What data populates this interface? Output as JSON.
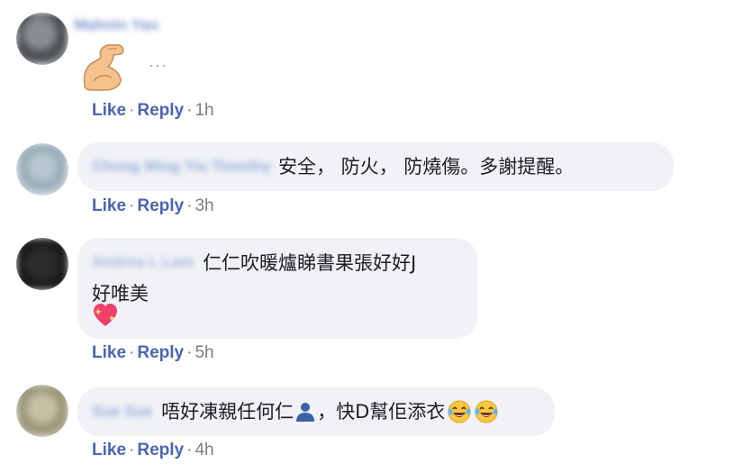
{
  "comments": [
    {
      "author": "Mahnin Yau",
      "text": "",
      "emoji": "flexed-biceps-emoji",
      "more": "···",
      "actions": {
        "like": "Like",
        "sep": "·",
        "reply": "Reply",
        "time": "1h"
      }
    },
    {
      "author": "Chong Ming Yiu Timothy",
      "text": "安全， 防火， 防燒傷。多謝提醒。",
      "actions": {
        "like": "Like",
        "sep": "·",
        "reply": "Reply",
        "time": "3h"
      }
    },
    {
      "author": "Andrea L Lam",
      "text_line1": "仁仁吹暖爐睇書果張好好J",
      "text_line2": "好唯美",
      "emoji": "sparkling-heart-emoji",
      "actions": {
        "like": "Like",
        "sep": "·",
        "reply": "Reply",
        "time": "5h"
      }
    },
    {
      "author": "Sue Sue",
      "text_a": "唔好凍親任何仁",
      "text_b": "，快D幫佢添衣",
      "emoji_a": "person-silhouette-emoji",
      "emoji_b": "tears-of-joy-emoji",
      "actions": {
        "like": "Like",
        "sep": "·",
        "reply": "Reply",
        "time": "4h"
      }
    }
  ],
  "colors": {
    "bubble": "#f0f2f5",
    "link": "#4a66ad",
    "muted": "#7a7d82"
  }
}
